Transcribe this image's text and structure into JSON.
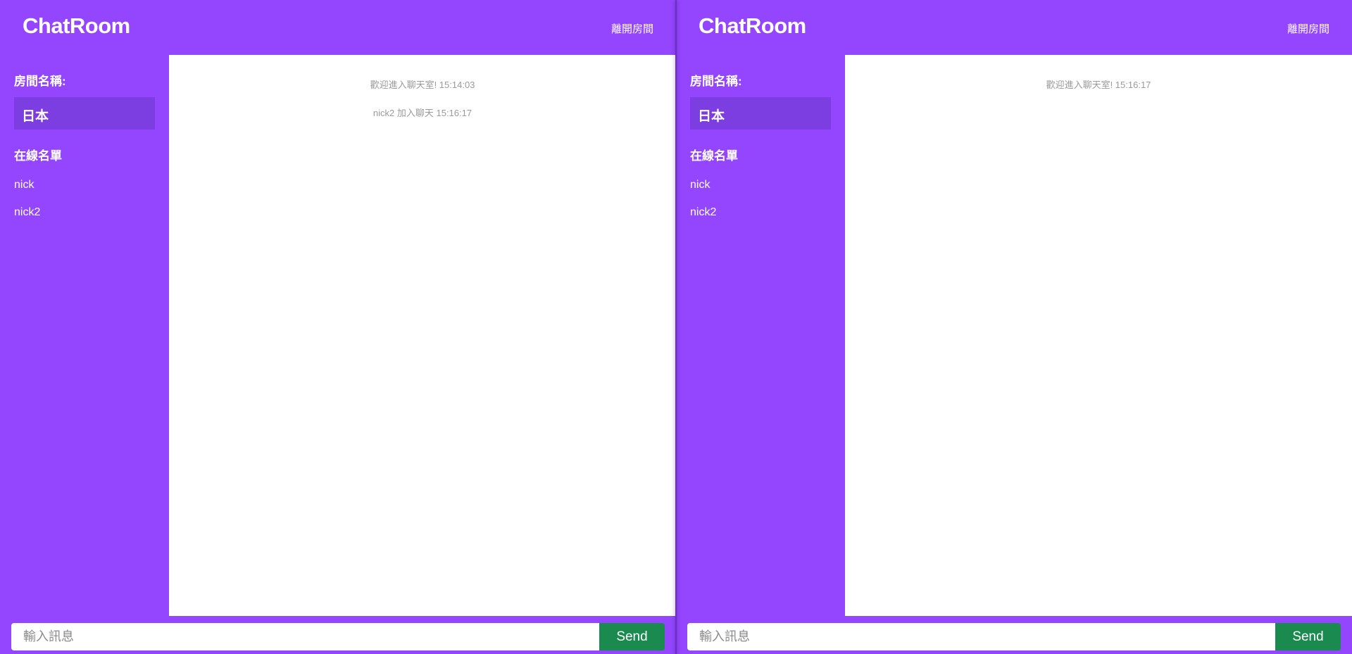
{
  "colors": {
    "primary": "#9446ff",
    "room_box": "#7c3ee0",
    "send_button": "#1a8a4e",
    "chat_bg": "#ffffff",
    "system_message_text": "#9a9a9a"
  },
  "panes": [
    {
      "header": {
        "logo": "ChatRoom",
        "leave_label": "離開房間"
      },
      "sidebar": {
        "room_label": "房間名稱:",
        "room_name": "日本",
        "online_label": "在線名單",
        "users": [
          "nick",
          "nick2"
        ]
      },
      "messages": [
        "歡迎進入聊天室! 15:14:03",
        "nick2 加入聊天 15:16:17"
      ],
      "input": {
        "placeholder": "輸入訊息",
        "value": "",
        "send_label": "Send"
      }
    },
    {
      "header": {
        "logo": "ChatRoom",
        "leave_label": "離開房間"
      },
      "sidebar": {
        "room_label": "房間名稱:",
        "room_name": "日本",
        "online_label": "在線名單",
        "users": [
          "nick",
          "nick2"
        ]
      },
      "messages": [
        "歡迎進入聊天室! 15:16:17"
      ],
      "input": {
        "placeholder": "輸入訊息",
        "value": "",
        "send_label": "Send"
      }
    }
  ]
}
